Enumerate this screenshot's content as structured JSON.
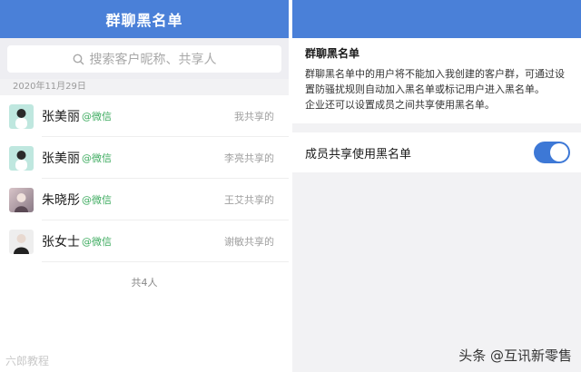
{
  "left": {
    "title": "群聊黑名单",
    "search_placeholder": "搜索客户昵称、共享人",
    "date": "2020年11月29日",
    "rows": [
      {
        "name": "张美丽",
        "tag": "@微信",
        "share": "我共享的"
      },
      {
        "name": "张美丽",
        "tag": "@微信",
        "share": "李亮共享的"
      },
      {
        "name": "朱晓彤",
        "tag": "@微信",
        "share": "王艾共享的"
      },
      {
        "name": "张女士",
        "tag": "@微信",
        "share": "谢敏共享的"
      }
    ],
    "total": "共4人"
  },
  "right": {
    "info_title": "群聊黑名单",
    "info_text_1": "群聊黑名单中的用户将不能加入我创建的客户群，可通过设置防骚扰规则自动加入黑名单或标记用户进入黑名单。",
    "info_text_2": "企业还可以设置成员之间共享使用黑名单。",
    "toggle_label": "成员共享使用黑名单",
    "toggle_on": true
  },
  "watermarks": {
    "left": "六郎教程",
    "right": "头条 @互讯新零售"
  },
  "colors": {
    "header": "#4a80d8",
    "toggle": "#3d78d6",
    "wechat_tag": "#3dab5f"
  }
}
